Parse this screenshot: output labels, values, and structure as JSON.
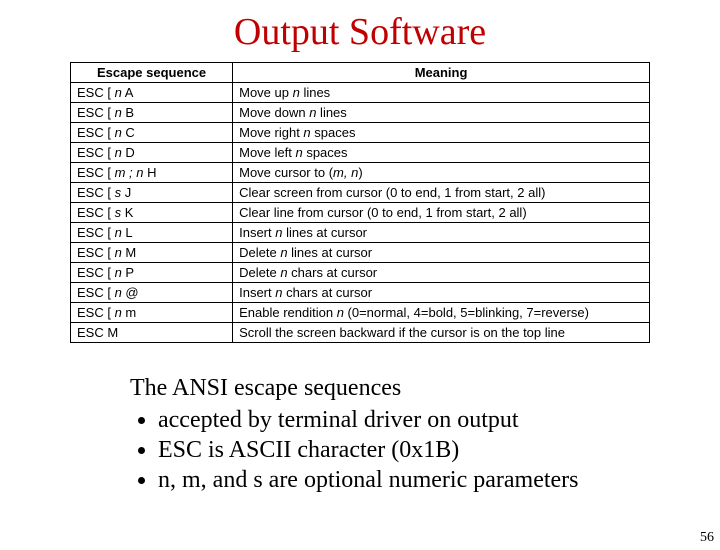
{
  "title": "Output Software",
  "table": {
    "headers": [
      "Escape sequence",
      "Meaning"
    ],
    "rows": [
      {
        "esc_pre": "ESC [ ",
        "esc_var": "n",
        "esc_post": " A",
        "meaning_pre": "Move up ",
        "meaning_var": "n",
        "meaning_post": " lines"
      },
      {
        "esc_pre": "ESC [ ",
        "esc_var": "n",
        "esc_post": " B",
        "meaning_pre": "Move down ",
        "meaning_var": "n",
        "meaning_post": " lines"
      },
      {
        "esc_pre": "ESC [ ",
        "esc_var": "n",
        "esc_post": " C",
        "meaning_pre": "Move right ",
        "meaning_var": "n",
        "meaning_post": " spaces"
      },
      {
        "esc_pre": "ESC [ ",
        "esc_var": "n",
        "esc_post": " D",
        "meaning_pre": "Move left ",
        "meaning_var": "n",
        "meaning_post": " spaces"
      },
      {
        "esc_pre": "ESC [ ",
        "esc_var": "m ; n",
        "esc_post": " H",
        "meaning_pre": "Move cursor to (",
        "meaning_var": "m, n",
        "meaning_post": ")"
      },
      {
        "esc_pre": "ESC [ ",
        "esc_var": "s",
        "esc_post": " J",
        "meaning_pre": "Clear screen from cursor (0 to end, 1 from start, 2 all)",
        "meaning_var": "",
        "meaning_post": ""
      },
      {
        "esc_pre": "ESC [ ",
        "esc_var": "s",
        "esc_post": " K",
        "meaning_pre": "Clear line from cursor (0 to end, 1 from start, 2 all)",
        "meaning_var": "",
        "meaning_post": ""
      },
      {
        "esc_pre": "ESC [ ",
        "esc_var": "n",
        "esc_post": " L",
        "meaning_pre": "Insert ",
        "meaning_var": "n",
        "meaning_post": " lines at cursor"
      },
      {
        "esc_pre": "ESC [ ",
        "esc_var": "n",
        "esc_post": " M",
        "meaning_pre": "Delete ",
        "meaning_var": "n",
        "meaning_post": " lines at cursor"
      },
      {
        "esc_pre": "ESC [ ",
        "esc_var": "n",
        "esc_post": " P",
        "meaning_pre": "Delete ",
        "meaning_var": "n",
        "meaning_post": " chars at cursor"
      },
      {
        "esc_pre": "ESC [ ",
        "esc_var": "n",
        "esc_post": " @",
        "meaning_pre": "Insert ",
        "meaning_var": "n",
        "meaning_post": " chars at cursor"
      },
      {
        "esc_pre": "ESC [ ",
        "esc_var": "n",
        "esc_post": " m",
        "meaning_pre": "Enable rendition ",
        "meaning_var": "n",
        "meaning_post": " (0=normal, 4=bold, 5=blinking, 7=reverse)"
      },
      {
        "esc_pre": "ESC M",
        "esc_var": "",
        "esc_post": "",
        "meaning_pre": "Scroll the screen backward if the cursor is on the top line",
        "meaning_var": "",
        "meaning_post": ""
      }
    ]
  },
  "notes": {
    "heading": "The ANSI escape sequences",
    "items": [
      "accepted by terminal driver on output",
      "ESC is ASCII character (0x1B)",
      "n, m, and s are optional numeric parameters"
    ]
  },
  "page_number": "56"
}
